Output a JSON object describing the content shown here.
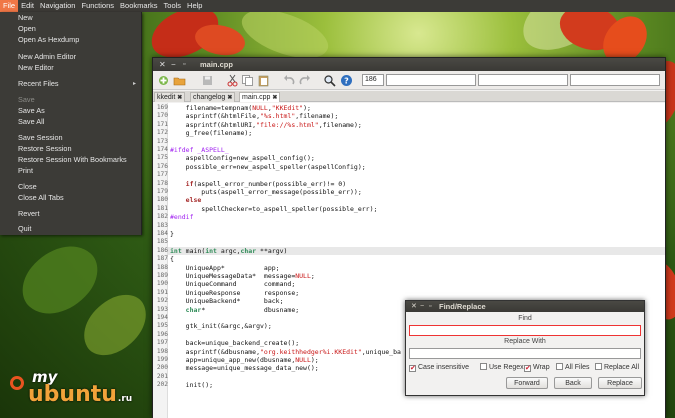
{
  "menubar": {
    "items": [
      "File",
      "Edit",
      "Navigation",
      "Functions",
      "Bookmarks",
      "Tools",
      "Help"
    ]
  },
  "file_menu": {
    "items": [
      {
        "label": "New",
        "enabled": true
      },
      {
        "label": "Open",
        "enabled": true
      },
      {
        "label": "Open As Hexdump",
        "enabled": true
      },
      {
        "label": "New Admin Editor",
        "enabled": true
      },
      {
        "label": "New Editor",
        "enabled": true
      },
      {
        "label": "Recent Files",
        "enabled": true,
        "submenu": true
      },
      {
        "label": "Save",
        "enabled": false
      },
      {
        "label": "Save As",
        "enabled": true
      },
      {
        "label": "Save All",
        "enabled": true
      },
      {
        "label": "Save Session",
        "enabled": true
      },
      {
        "label": "Restore Session",
        "enabled": true
      },
      {
        "label": "Restore Session With Bookmarks",
        "enabled": true
      },
      {
        "label": "Print",
        "enabled": true
      },
      {
        "label": "Close",
        "enabled": true
      },
      {
        "label": "Close All Tabs",
        "enabled": true
      },
      {
        "label": "Revert",
        "enabled": true
      },
      {
        "label": "Quit",
        "enabled": true
      }
    ]
  },
  "window": {
    "title": "main.cpp",
    "toolbar": {
      "line_input": "186",
      "icons": [
        "new-file-icon",
        "open-folder-icon",
        "save-icon",
        "cut-icon",
        "copy-icon",
        "paste-icon",
        "undo-icon",
        "redo-icon",
        "find-icon",
        "help-icon"
      ]
    },
    "tabs": [
      {
        "label": "kkedit",
        "active": false
      },
      {
        "label": "changelog",
        "active": false
      },
      {
        "label": "main.cpp",
        "active": true
      }
    ]
  },
  "editor": {
    "current_line": "186",
    "lines": [
      {
        "n": "169",
        "t": "    filename=tempnam(NULL,\"KKEdit\");"
      },
      {
        "n": "170",
        "t": "    asprintf(&htmlFile,\"%s.html\",filename);"
      },
      {
        "n": "171",
        "t": "    asprintf(&htmlURI,\"file://%s.html\",filename);"
      },
      {
        "n": "172",
        "t": "    g_free(filename);"
      },
      {
        "n": "173",
        "t": ""
      },
      {
        "n": "174",
        "t": "#ifdef _ASPELL_"
      },
      {
        "n": "175",
        "t": "    aspellConfig=new_aspell_config();"
      },
      {
        "n": "176",
        "t": "    possible_err=new_aspell_speller(aspellConfig);"
      },
      {
        "n": "177",
        "t": ""
      },
      {
        "n": "178",
        "t": "    if(aspell_error_number(possible_err)!= 0)"
      },
      {
        "n": "179",
        "t": "        puts(aspell_error_message(possible_err));"
      },
      {
        "n": "180",
        "t": "    else"
      },
      {
        "n": "181",
        "t": "        spellChecker=to_aspell_speller(possible_err);"
      },
      {
        "n": "182",
        "t": "#endif"
      },
      {
        "n": "183",
        "t": ""
      },
      {
        "n": "184",
        "t": "}"
      },
      {
        "n": "185",
        "t": ""
      },
      {
        "n": "186",
        "t": "int main(int argc,char **argv)"
      },
      {
        "n": "187",
        "t": "{"
      },
      {
        "n": "188",
        "t": "    UniqueApp*          app;"
      },
      {
        "n": "189",
        "t": "    UniqueMessageData*  message=NULL;"
      },
      {
        "n": "190",
        "t": "    UniqueCommand       command;"
      },
      {
        "n": "191",
        "t": "    UniqueResponse      response;"
      },
      {
        "n": "192",
        "t": "    UniqueBackend*      back;"
      },
      {
        "n": "193",
        "t": "    char*               dbusname;"
      },
      {
        "n": "194",
        "t": ""
      },
      {
        "n": "195",
        "t": "    gtk_init(&argc,&argv);"
      },
      {
        "n": "196",
        "t": ""
      },
      {
        "n": "197",
        "t": "    back=unique_backend_create();"
      },
      {
        "n": "198",
        "t": "    asprintf(&dbusname,\"org.keithhedger%i.KKEdit\",unique_ba"
      },
      {
        "n": "199",
        "t": "    app=unique_app_new(dbusname,NULL);"
      },
      {
        "n": "200",
        "t": "    message=unique_message_data_new();"
      },
      {
        "n": "201",
        "t": ""
      },
      {
        "n": "202",
        "t": "    init();"
      }
    ]
  },
  "find_replace": {
    "title": "Find/Replace",
    "find_label": "Find",
    "replace_label": "Replace With",
    "find_value": "",
    "replace_value": "",
    "options": [
      {
        "label": "Case insensitive",
        "checked": true
      },
      {
        "label": "Use Regex",
        "checked": false
      },
      {
        "label": "Wrap",
        "checked": true
      },
      {
        "label": "All Files",
        "checked": false
      },
      {
        "label": "Replace All",
        "checked": false
      }
    ],
    "buttons": [
      "Forward",
      "Back",
      "Replace"
    ]
  },
  "logo": {
    "line1": "my",
    "line2": "ubuntu",
    "suffix": ".ru"
  },
  "colors": {
    "accent": "#f07746",
    "panel": "#3c3b37",
    "current_line": "#e8e8e8"
  }
}
